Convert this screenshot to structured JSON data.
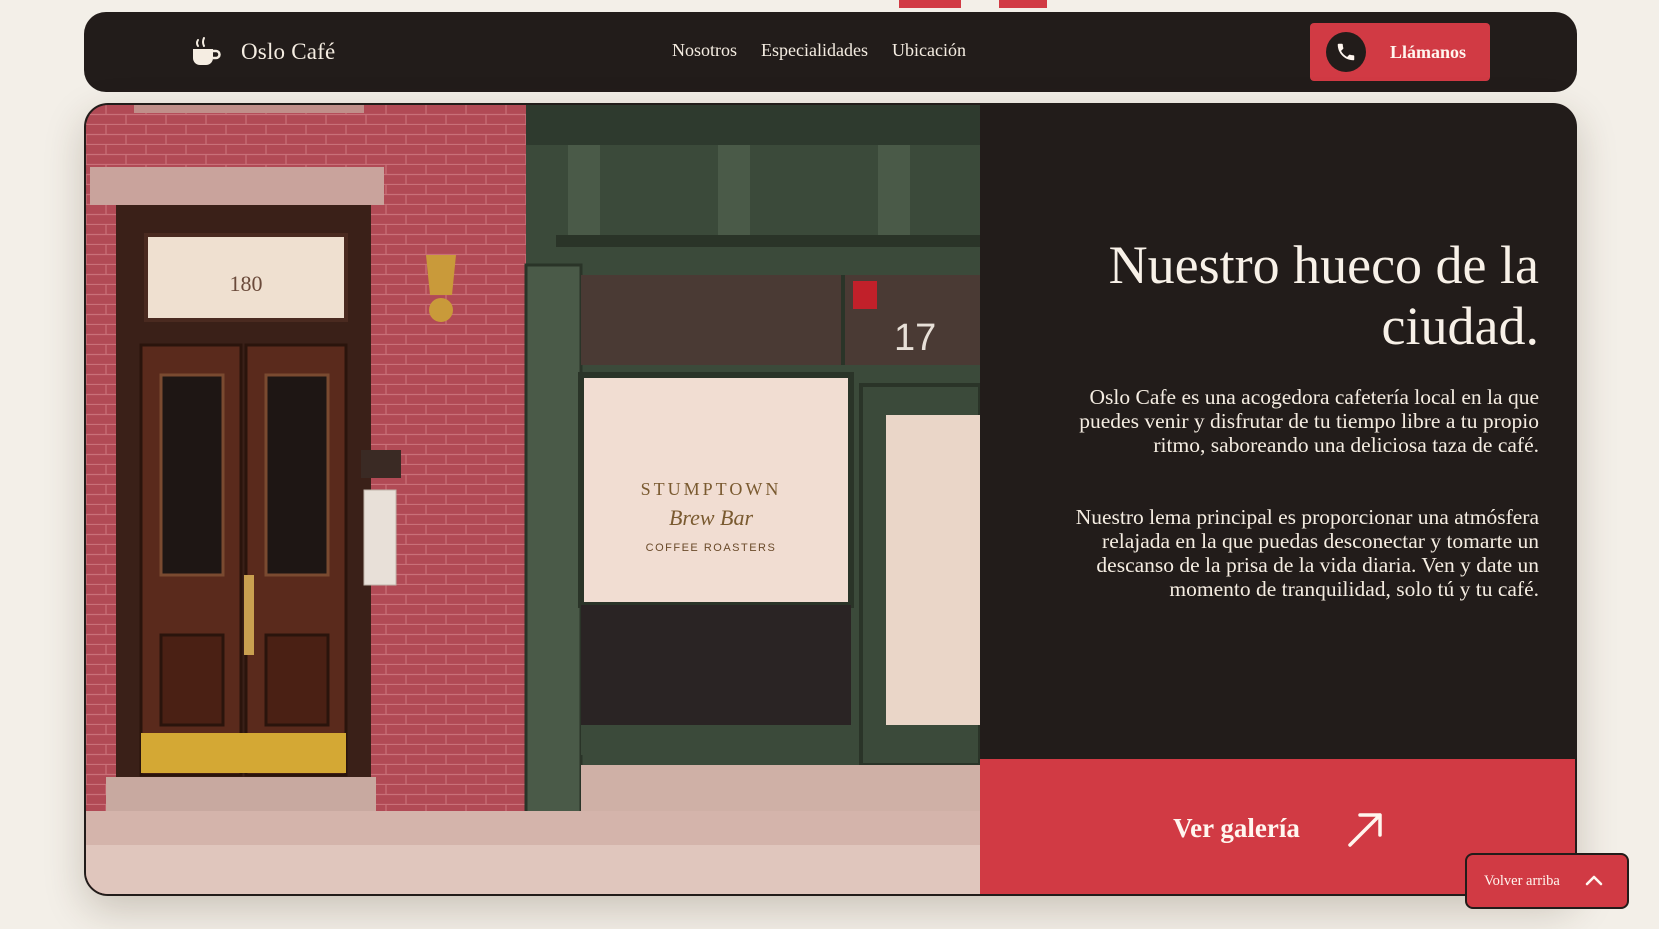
{
  "colors": {
    "accent": "#d13a44",
    "dark": "#221c1a",
    "background": "#f3efe8",
    "light_text": "#f5ede2"
  },
  "header": {
    "brand_icon": "coffee-cup-icon",
    "brand_name": "Oslo Café",
    "nav": [
      "Nosotros",
      "Especialidades",
      "Ubicación"
    ],
    "call_button": {
      "icon": "phone-icon",
      "label": "Llámanos"
    }
  },
  "hero": {
    "photo": {
      "door_number": "180",
      "sign_line1": "STUMPTOWN",
      "sign_line2": "Brew Bar",
      "sign_line3": "COFFEE ROASTERS",
      "neighbor_number": "17"
    },
    "title": "Nuestro hueco de la ciudad.",
    "paragraph1": "Oslo Cafe es una acogedora cafetería local en la que puedes venir y disfrutar de tu tiempo libre a tu propio ritmo, saboreando una deliciosa taza de café.",
    "paragraph2": "Nuestro lema principal es proporcionar una atmósfera relajada en la que puedas desconectar y tomarte un descanso de la prisa de la vida diaria. Ven y date un momento de tranquilidad, solo tú y tu café.",
    "gallery_button": {
      "label": "Ver galería",
      "icon": "arrow-up-right-icon"
    }
  },
  "back_to_top": {
    "label": "Volver arriba",
    "icon": "chevron-up-icon"
  }
}
